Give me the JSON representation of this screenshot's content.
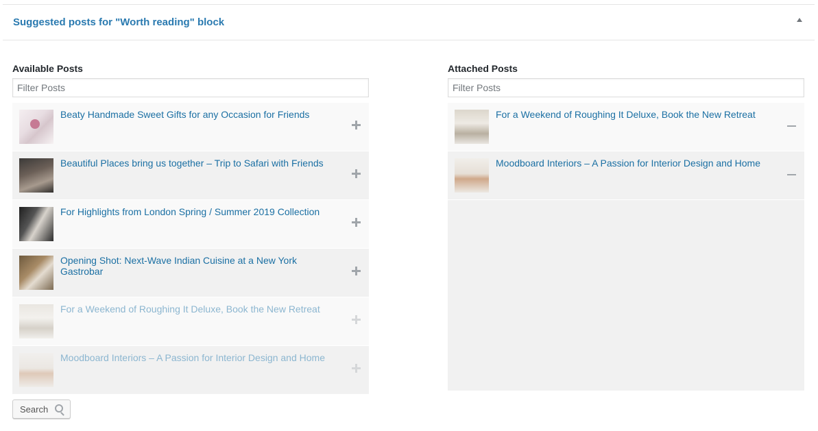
{
  "metabox": {
    "title": "Suggested posts for \"Worth reading\" block"
  },
  "available": {
    "heading": "Available Posts",
    "filter_placeholder": "Filter Posts",
    "items": [
      {
        "title": "Beaty Handmade Sweet Gifts for any Occasion for Friends",
        "thumb": "flowers-thumbnail"
      },
      {
        "title": "Beautiful Places bring us together – Trip to Safari with Friends",
        "thumb": "safari-thumbnail"
      },
      {
        "title": "For Highlights from London Spring / Summer 2019 Collection",
        "thumb": "fashion-thumbnail"
      },
      {
        "title": "Opening Shot: Next-Wave Indian Cuisine at a New York Gastrobar",
        "thumb": "cuisine-thumbnail"
      },
      {
        "title": "For a Weekend of Roughing It Deluxe, Book the New Retreat",
        "thumb": "retreat-thumbnail"
      },
      {
        "title": "Moodboard Interiors – A Passion for Interior Design and Home",
        "thumb": "interior-thumbnail"
      }
    ]
  },
  "attached": {
    "heading": "Attached Posts",
    "filter_placeholder": "Filter Posts",
    "items": [
      {
        "title": "For a Weekend of Roughing It Deluxe, Book the New Retreat",
        "thumb": "retreat-thumbnail"
      },
      {
        "title": "Moodboard Interiors – A Passion for Interior Design and Home",
        "thumb": "interior-thumbnail"
      }
    ]
  },
  "search_button": {
    "label": "Search",
    "icon": "magnifier-icon"
  },
  "colors": {
    "link": "#1a6fa3",
    "link_faded": "#8cb6d0",
    "title": "#2a7ab0"
  }
}
